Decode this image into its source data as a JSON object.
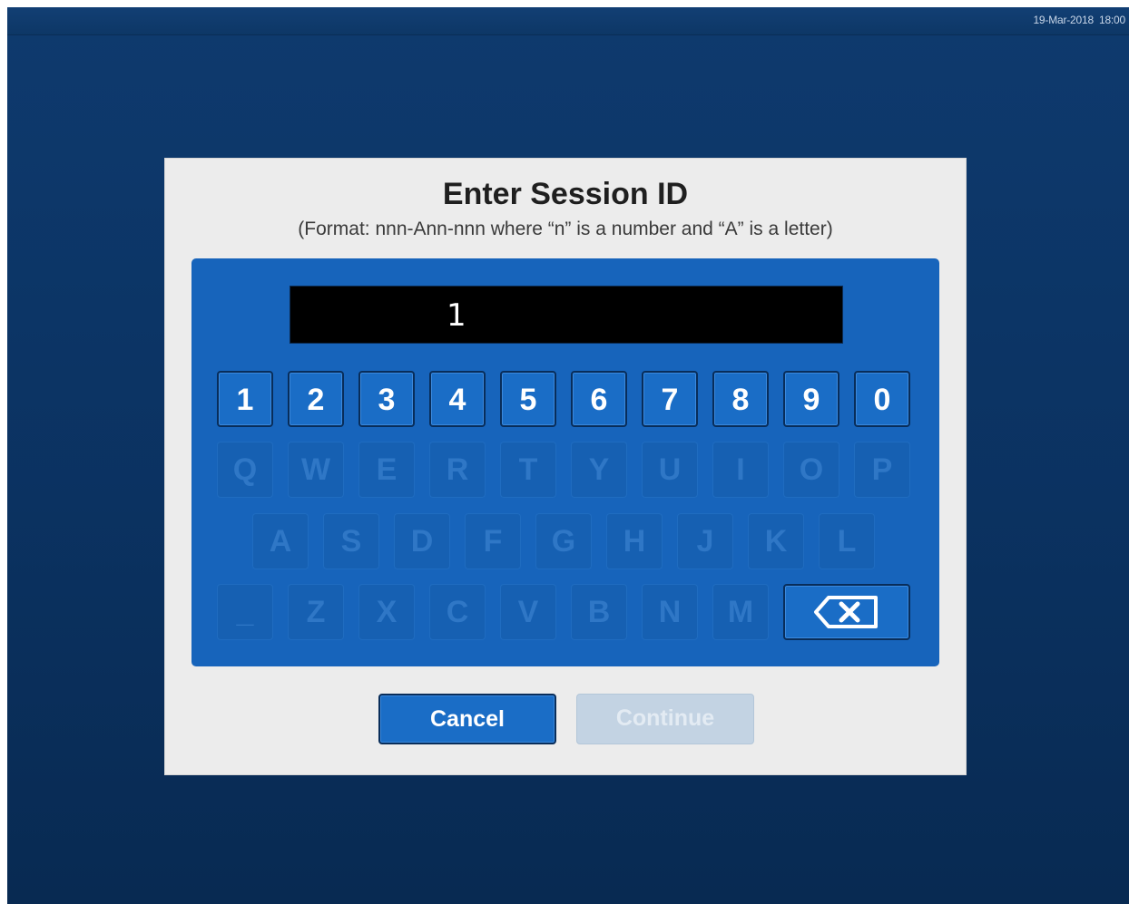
{
  "status_bar": {
    "date": "19-Mar-2018",
    "time": "18:00"
  },
  "dialog": {
    "title": "Enter Session ID",
    "subtitle": "(Format: nnn-Ann-nnn where “n” is a number and “A” is a letter)",
    "input_value": "1"
  },
  "keyboard": {
    "row1": [
      "1",
      "2",
      "3",
      "4",
      "5",
      "6",
      "7",
      "8",
      "9",
      "0"
    ],
    "row2": [
      "Q",
      "W",
      "E",
      "R",
      "T",
      "Y",
      "U",
      "I",
      "O",
      "P"
    ],
    "row3": [
      "A",
      "S",
      "D",
      "F",
      "G",
      "H",
      "J",
      "K",
      "L"
    ],
    "row4": [
      "_",
      "Z",
      "X",
      "C",
      "V",
      "B",
      "N",
      "M"
    ],
    "backspace_icon": "backspace-icon",
    "digit_keys_enabled": true,
    "letter_keys_enabled": false
  },
  "buttons": {
    "cancel": "Cancel",
    "continue": "Continue",
    "continue_enabled": false
  },
  "colors": {
    "panel": "#1764bb",
    "key_active": "#1a6dc6",
    "key_disabled": "#1660b2",
    "button_disabled": "#c3d3e3"
  }
}
